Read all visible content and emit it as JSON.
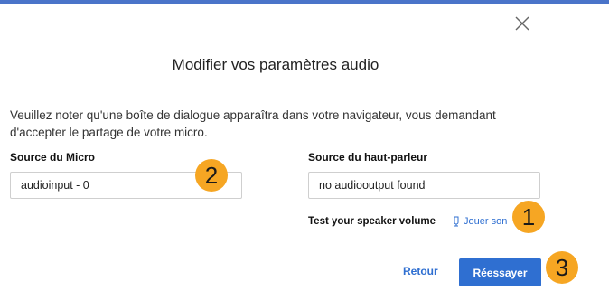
{
  "dialog": {
    "title": "Modifier vos paramètres audio",
    "notice": "Veuillez noter qu'une boîte de dialogue apparaîtra dans votre navigateur, vous demandant d'accepter le partage de votre micro.",
    "close_icon": "close-x-icon"
  },
  "microphone": {
    "label": "Source du Micro",
    "selected": "audioinput - 0"
  },
  "speaker": {
    "label": "Source du haut-parleur",
    "selected": "no audiooutput found",
    "test_label": "Test your speaker volume",
    "play_label": "Jouer son",
    "play_icon": "speaker-icon"
  },
  "actions": {
    "back_label": "Retour",
    "retry_label": "Réessayer"
  },
  "annotations": {
    "badge_1": "1",
    "badge_2": "2",
    "badge_3": "3"
  },
  "colors": {
    "accent": "#2f6fd1",
    "top_bar": "#4a74c9",
    "badge": "#f6a623"
  }
}
